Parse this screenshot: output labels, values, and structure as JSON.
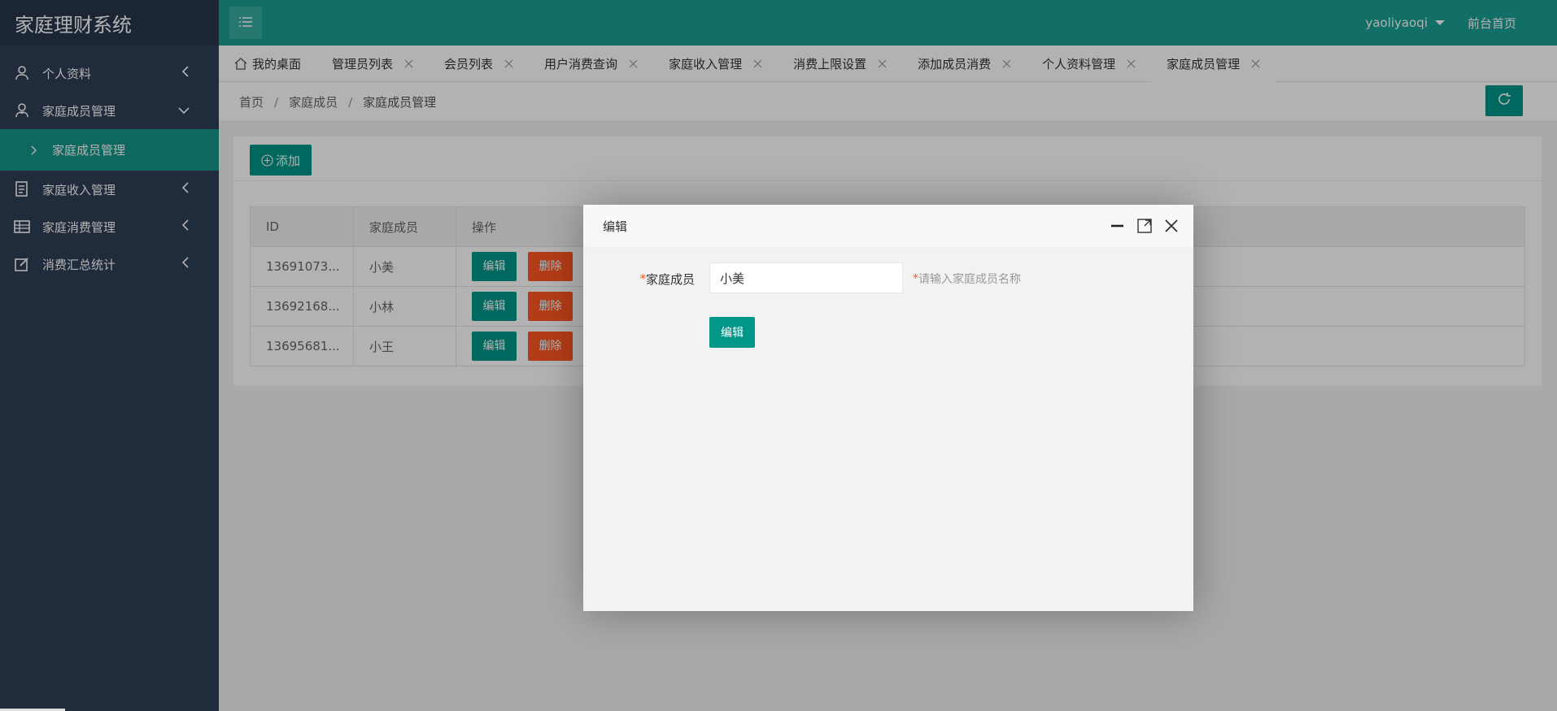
{
  "app": {
    "title": "家庭理财系统"
  },
  "sidebar": {
    "items": [
      {
        "label": "个人资料",
        "icon": "user-icon",
        "expanded": false
      },
      {
        "label": "家庭成员管理",
        "icon": "user-icon",
        "expanded": true,
        "children": [
          {
            "label": "家庭成员管理",
            "active": true
          }
        ]
      },
      {
        "label": "家庭收入管理",
        "icon": "document-icon",
        "expanded": false
      },
      {
        "label": "家庭消费管理",
        "icon": "table-icon",
        "expanded": false
      },
      {
        "label": "消费汇总统计",
        "icon": "edit-icon",
        "expanded": false
      }
    ]
  },
  "topbar": {
    "username": "yaoliyaoqi",
    "front_link": "前台首页"
  },
  "tabs": [
    {
      "label": "我的桌面",
      "closable": false
    },
    {
      "label": "管理员列表",
      "closable": true
    },
    {
      "label": "会员列表",
      "closable": true
    },
    {
      "label": "用户消费查询",
      "closable": true
    },
    {
      "label": "家庭收入管理",
      "closable": true
    },
    {
      "label": "消费上限设置",
      "closable": true
    },
    {
      "label": "添加成员消费",
      "closable": true
    },
    {
      "label": "个人资料管理",
      "closable": true
    },
    {
      "label": "家庭成员管理",
      "closable": true,
      "active": true
    }
  ],
  "breadcrumb": [
    "首页",
    "家庭成员",
    "家庭成员管理"
  ],
  "toolbar": {
    "add_label": "添加"
  },
  "table": {
    "columns": [
      "ID",
      "家庭成员",
      "操作"
    ],
    "rows": [
      {
        "id": "13691073...",
        "name": "小美"
      },
      {
        "id": "13692168...",
        "name": "小林"
      },
      {
        "id": "13695681...",
        "name": "小王"
      }
    ],
    "edit_label": "编辑",
    "delete_label": "删除"
  },
  "modal": {
    "title": "编辑",
    "field_label": "家庭成员",
    "field_value": "小美",
    "required_mark": "*",
    "hint": "请输入家庭成员名称",
    "submit_label": "编辑"
  },
  "colors": {
    "primary": "#009688",
    "danger": "#ff5722",
    "sidebar": "#2f3e56",
    "topbar": "#1aa094"
  }
}
